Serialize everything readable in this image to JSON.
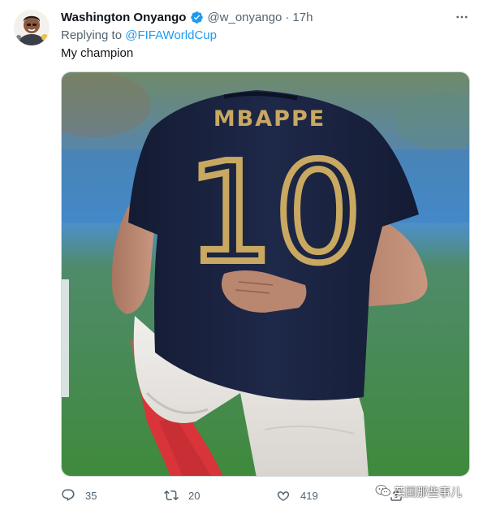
{
  "tweet": {
    "author": {
      "display_name": "Washington Onyango",
      "handle": "@w_onyango",
      "verified": true
    },
    "timestamp": "17h",
    "separator": "·",
    "reply_prefix": "Replying to",
    "reply_to": "@FIFAWorldCup",
    "text": "My champion",
    "media": {
      "jersey_name": "MBAPPE",
      "jersey_number": "10"
    },
    "stats": {
      "replies": "35",
      "retweets": "20",
      "likes": "419"
    }
  },
  "watermark": {
    "text": "英国那些事儿"
  },
  "colors": {
    "accent": "#1d9bf0",
    "secondary_text": "#536471",
    "jersey": "#1c2544",
    "gold": "#c9a861"
  },
  "icons": [
    "avatar",
    "verified-badge-icon",
    "more-icon",
    "reply-icon",
    "retweet-icon",
    "like-icon",
    "share-icon",
    "wechat-icon"
  ]
}
